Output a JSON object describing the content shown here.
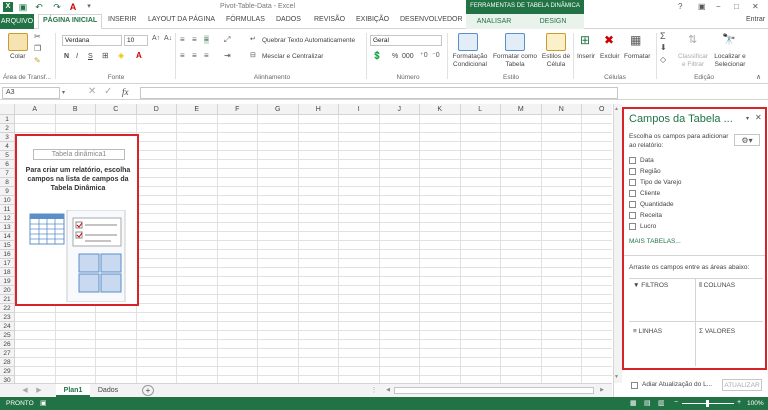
{
  "titlebar": {
    "title": "Pivot-Table-Data - Excel",
    "contextual_title": "FERRAMENTAS DE TABELA DINÂMICA",
    "help": "?",
    "minimize": "−",
    "restore": "□",
    "close": "✕",
    "user": "Entrar"
  },
  "tabs": {
    "file": "ARQUIVO",
    "items": [
      "PÁGINA INICIAL",
      "INSERIR",
      "LAYOUT DA PÁGINA",
      "FÓRMULAS",
      "DADOS",
      "REVISÃO",
      "EXIBIÇÃO",
      "DESENVOLVEDOR"
    ],
    "contextual": [
      "ANALISAR",
      "DESIGN"
    ]
  },
  "ribbon": {
    "clipboard": {
      "paste": "Colar",
      "group": "Área de Transf..."
    },
    "font": {
      "family": "Verdana",
      "size": "10",
      "bold": "N",
      "italic": "I",
      "underline": "S",
      "group": "Fonte"
    },
    "alignment": {
      "wrap": "Quebrar Texto Automaticamente",
      "merge": "Mesclar e Centralizar",
      "group": "Alinhamento"
    },
    "number": {
      "format": "Geral",
      "percent": "%",
      "thousands": "000",
      "group": "Número"
    },
    "styles": {
      "conditional": "Formatação Condicional",
      "as_table": "Formatar como Tabela",
      "cell_styles": "Estilos de Célula",
      "group": "Estilo"
    },
    "cells": {
      "insert": "Inserir",
      "delete": "Excluir",
      "format": "Formatar",
      "group": "Células"
    },
    "editing": {
      "sort": "Classificar e Filtrar",
      "find": "Localizar e Selecionar",
      "group": "Edição"
    }
  },
  "formula_bar": {
    "name_box": "A3",
    "fx": "fx",
    "value": ""
  },
  "grid": {
    "columns": [
      "A",
      "B",
      "C",
      "D",
      "E",
      "F",
      "G",
      "H",
      "I",
      "J",
      "K",
      "L",
      "M",
      "N",
      "O"
    ],
    "rows": [
      "1",
      "2",
      "3",
      "4",
      "5",
      "6",
      "7",
      "8",
      "9",
      "10",
      "11",
      "12",
      "13",
      "14",
      "15",
      "16",
      "17",
      "18",
      "19",
      "20",
      "21",
      "22",
      "23",
      "24",
      "25",
      "26",
      "27",
      "28",
      "29",
      "30"
    ]
  },
  "pivot_placeholder": {
    "title": "Tabela dinâmica1",
    "message": "Para criar um relatório, escolha campos na lista de campos da Tabela Dinâmica"
  },
  "sheet_tabs": {
    "items": [
      "Plan1",
      "Dados"
    ],
    "add": "+"
  },
  "status": {
    "ready": "PRONTO",
    "zoom": "100%"
  },
  "pivot_panel": {
    "title": "Campos da Tabela ...",
    "subtitle": "Escolha os campos para adicionar ao relatório:",
    "fields": [
      "Data",
      "Região",
      "Tipo de Varejo",
      "Cliente",
      "Quantidade",
      "Receita",
      "Lucro"
    ],
    "more_tables": "MAIS TABELAS...",
    "drag_hint": "Arraste os campos entre as áreas abaixo:",
    "areas": {
      "filters": "FILTROS",
      "columns": "COLUNAS",
      "rows": "LINHAS",
      "values": "VALORES"
    },
    "defer_update": "Adiar Atualização do L...",
    "update_button": "ATUALIZAR"
  }
}
